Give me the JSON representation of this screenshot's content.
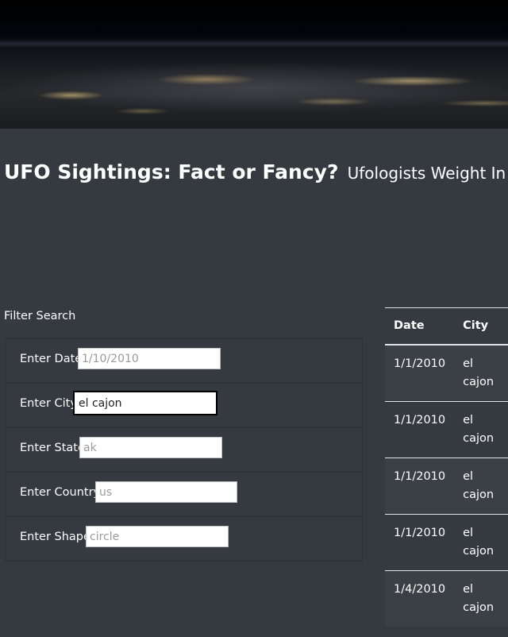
{
  "header": {
    "title": "UFO Sightings: Fact or Fancy?",
    "subtitle": "Ufologists Weight In"
  },
  "filter": {
    "title": "Filter Search",
    "fields": [
      {
        "label": "Enter Date",
        "value": "",
        "placeholder": "1/10/2010"
      },
      {
        "label": "Enter City",
        "value": "el cajon",
        "placeholder": ""
      },
      {
        "label": "Enter State",
        "value": "",
        "placeholder": "ak"
      },
      {
        "label": "Enter Country",
        "value": "",
        "placeholder": "us"
      },
      {
        "label": "Enter Shape",
        "value": "",
        "placeholder": "circle"
      }
    ]
  },
  "table": {
    "columns": [
      "Date",
      "City"
    ],
    "rows": [
      {
        "date": "1/1/2010",
        "city": "el cajon"
      },
      {
        "date": "1/1/2010",
        "city": "el cajon"
      },
      {
        "date": "1/1/2010",
        "city": "el cajon"
      },
      {
        "date": "1/1/2010",
        "city": "el cajon"
      },
      {
        "date": "1/4/2010",
        "city": "el cajon"
      }
    ]
  }
}
